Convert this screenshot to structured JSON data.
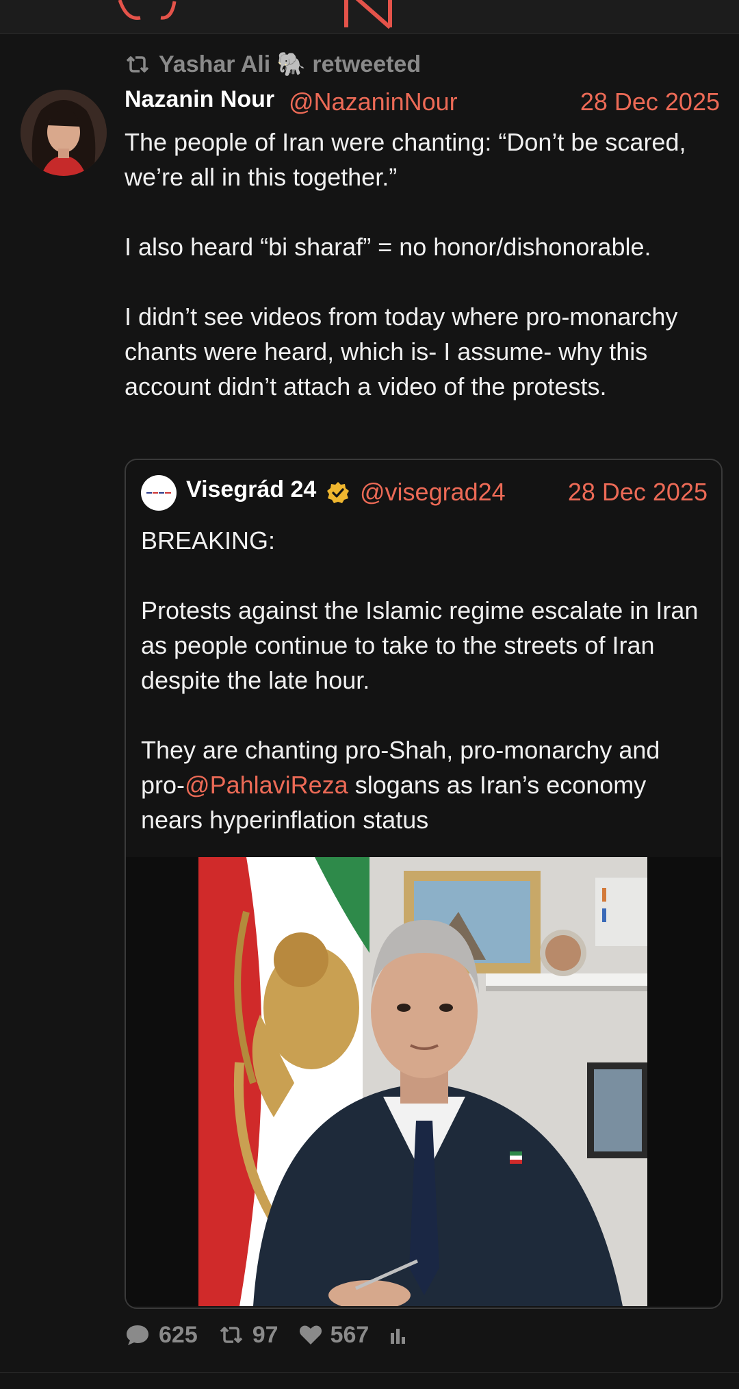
{
  "retweet": {
    "label": "Yashar Ali 🐘 retweeted"
  },
  "tweet": {
    "author_name": "Nazanin Nour",
    "author_handle": "@NazaninNour",
    "date": "28 Dec 2025",
    "paragraphs": [
      "The people of Iran were chanting: “Don’t be scared, we’re all in this together.”",
      "I also heard “bi sharaf” = no honor/dishonorable.",
      "I didn’t see videos from today where pro-monarchy chants were heard, which is- I assume- why this account didn’t attach a video of the protests."
    ]
  },
  "quote": {
    "author_name": "Visegrád 24",
    "author_handle": "@visegrad24",
    "date": "28 Dec 2025",
    "paragraph1": "BREAKING:",
    "paragraph2": "Protests against the Islamic regime escalate in Iran as people continue to take to the streets of Iran despite the late hour.",
    "paragraph3_before": "They are chanting pro-Shah, pro-monarchy and pro-",
    "mention": "@PahlaviReza",
    "paragraph3_after": " slogans as Iran’s economy nears hyperinflation status"
  },
  "actions": {
    "replies": "625",
    "retweets": "97",
    "likes": "567"
  },
  "colors": {
    "accent": "#ec6a56",
    "background": "#141414",
    "muted": "#8a8a8a",
    "verified": "#f0b72f"
  },
  "icons": [
    "retweet-icon",
    "reply-icon",
    "like-icon",
    "stats-icon",
    "verified-badge-icon",
    "elephant-emoji"
  ]
}
